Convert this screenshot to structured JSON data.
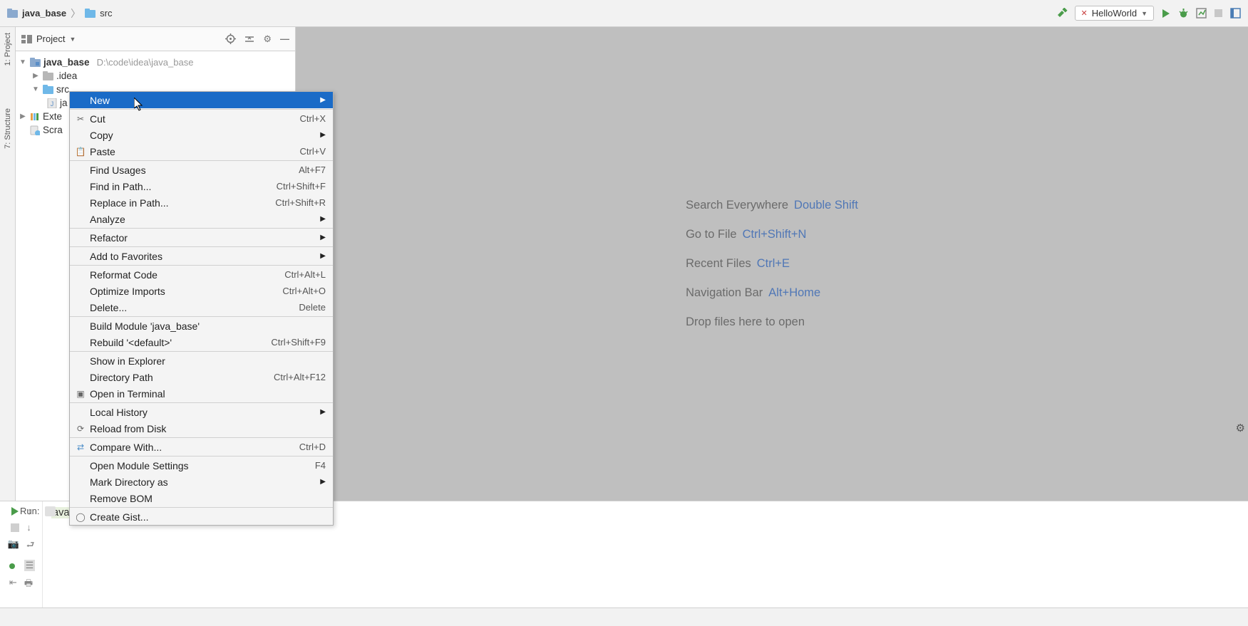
{
  "breadcrumb": {
    "root": "java_base",
    "child": "src"
  },
  "runConfig": {
    "name": "HelloWorld"
  },
  "sidebar": {
    "projectTab": "1: Project",
    "structureTab": "7: Structure"
  },
  "projectPanel": {
    "title": "Project",
    "root": {
      "name": "java_base",
      "path": "D:\\code\\idea\\java_base"
    },
    "idea": ".idea",
    "src": "src",
    "javaItem": "ja",
    "external": "Exte",
    "scratches": "Scra"
  },
  "tips": {
    "searchEverywhere": {
      "label": "Search Everywhere",
      "key": "Double Shift"
    },
    "goToFile": {
      "label": "Go to File",
      "key": "Ctrl+Shift+N"
    },
    "recentFiles": {
      "label": "Recent Files",
      "key": "Ctrl+E"
    },
    "navBar": {
      "label": "Navigation Bar",
      "key": "Alt+Home"
    },
    "drop": "Drop files here to open"
  },
  "contextMenu": {
    "new": "New",
    "cut": {
      "label": "Cut",
      "key": "Ctrl+X"
    },
    "copy": "Copy",
    "paste": {
      "label": "Paste",
      "key": "Ctrl+V"
    },
    "findUsages": {
      "label": "Find Usages",
      "key": "Alt+F7"
    },
    "findInPath": {
      "label": "Find in Path...",
      "key": "Ctrl+Shift+F"
    },
    "replaceInPath": {
      "label": "Replace in Path...",
      "key": "Ctrl+Shift+R"
    },
    "analyze": "Analyze",
    "refactor": "Refactor",
    "addFavorites": "Add to Favorites",
    "reformat": {
      "label": "Reformat Code",
      "key": "Ctrl+Alt+L"
    },
    "optimize": {
      "label": "Optimize Imports",
      "key": "Ctrl+Alt+O"
    },
    "delete": {
      "label": "Delete...",
      "key": "Delete"
    },
    "buildModule": "Build Module 'java_base'",
    "rebuild": {
      "label": "Rebuild '<default>'",
      "key": "Ctrl+Shift+F9"
    },
    "showExplorer": "Show in Explorer",
    "dirPath": {
      "label": "Directory Path",
      "key": "Ctrl+Alt+F12"
    },
    "openTerminal": "Open in Terminal",
    "localHistory": "Local History",
    "reload": "Reload from Disk",
    "compare": {
      "label": "Compare With...",
      "key": "Ctrl+D"
    },
    "openModule": {
      "label": "Open Module Settings",
      "key": "F4"
    },
    "markDir": "Mark Directory as",
    "removeBOM": "Remove BOM",
    "createGist": "Create Gist..."
  },
  "runPanel": {
    "label": "Run:",
    "output": "ava.exe\" ..."
  }
}
